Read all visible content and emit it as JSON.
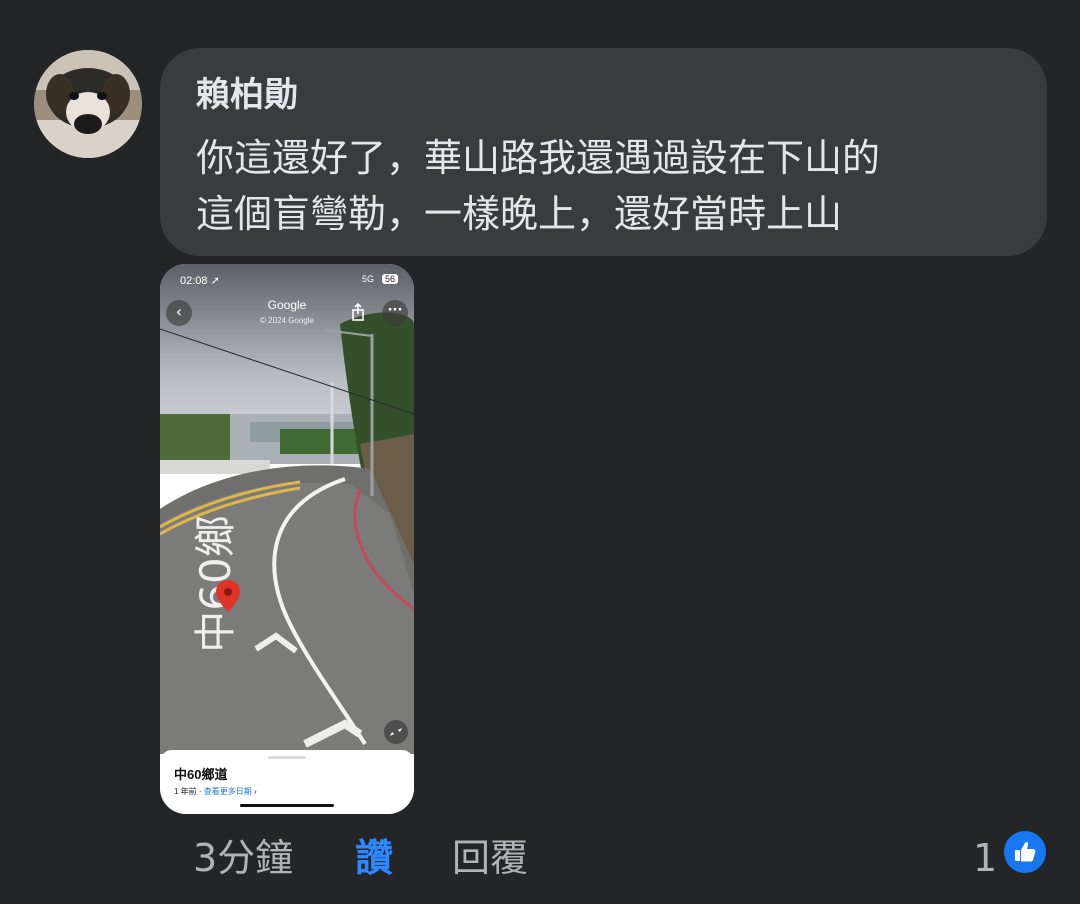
{
  "comment": {
    "author": "賴柏勛",
    "line1": "你這還好了，華山路我還遇過設在下山的",
    "line2": "這個盲彎勒，一樣晚上，還好當時上山",
    "avatar_icon": "dog-avatar"
  },
  "attachment": {
    "status_time": "02:08 ➚",
    "status_network": "5G",
    "status_battery": "56",
    "brand": "Google",
    "copyright": "© 2024 Google",
    "road_marking": "中60鄉",
    "place_name": "中60鄉道",
    "meta_prefix": "1 年前 · ",
    "meta_link": "查看更多日期",
    "meta_suffix": " ›"
  },
  "actions": {
    "time": "3分鐘",
    "like": "讚",
    "reply": "回覆",
    "reaction_count": "1"
  },
  "colors": {
    "background": "#242526",
    "bubble": "#3a3b3c",
    "like_active": "#2d88ff",
    "badge": "#1877f2"
  }
}
